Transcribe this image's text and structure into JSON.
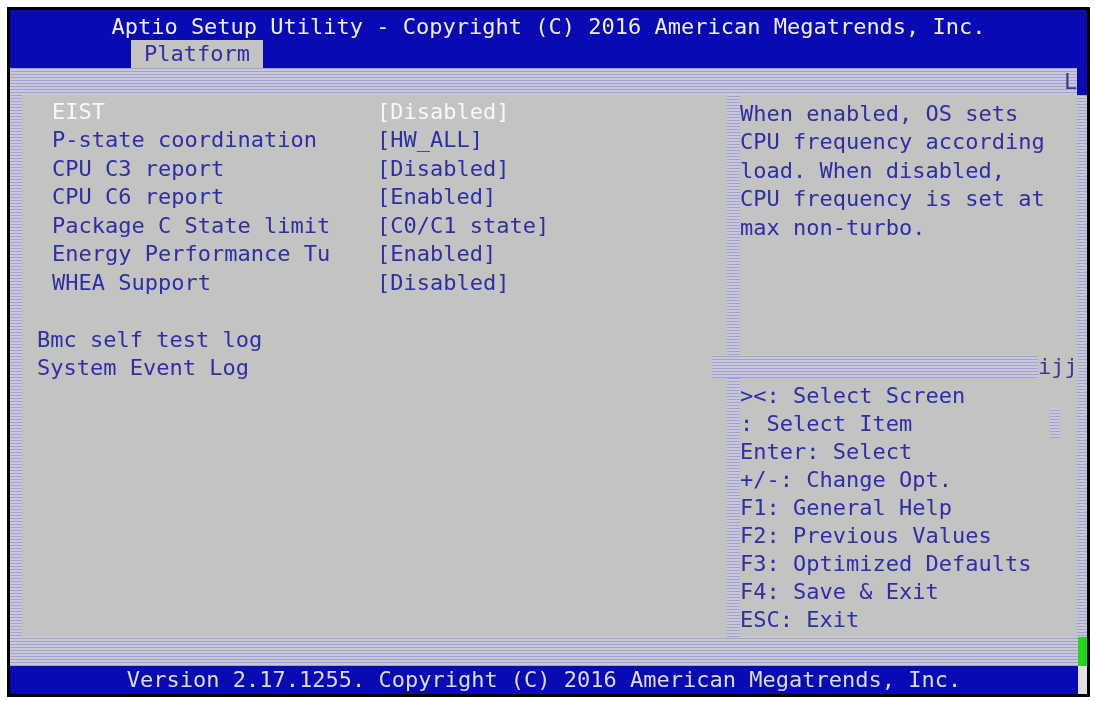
{
  "window": {
    "title": "Aptio Setup Utility - Copyright (C) 2016 American Megatrends, Inc."
  },
  "tabs": [
    {
      "label": "Platform",
      "selected": true
    }
  ],
  "frame_glyphs": {
    "top_right": "L",
    "divider": "ijj"
  },
  "settings": [
    {
      "kind": "option",
      "label": "EIST",
      "value": "[Disabled]",
      "selected": true
    },
    {
      "kind": "option",
      "label": "P-state coordination",
      "value": "[HW_ALL]",
      "selected": false
    },
    {
      "kind": "option",
      "label": "CPU C3 report",
      "value": "[Disabled]",
      "selected": false
    },
    {
      "kind": "option",
      "label": "CPU C6 report",
      "value": "[Enabled]",
      "selected": false
    },
    {
      "kind": "option",
      "label": "Package C State limit",
      "value": "[C0/C1 state]",
      "selected": false
    },
    {
      "kind": "option",
      "label": "Energy Performance Tu",
      "value": "[Enabled]",
      "selected": false
    },
    {
      "kind": "option",
      "label": "WHEA Support",
      "value": "[Disabled]",
      "selected": false
    },
    {
      "kind": "submenu",
      "label": "Bmc self test log",
      "selected": false
    },
    {
      "kind": "submenu",
      "label": "System Event Log",
      "selected": false
    }
  ],
  "help_text": "When enabled, OS sets CPU frequency according load. When disabled, CPU frequency is set at max non-turbo.",
  "key_hints": [
    "><: Select Screen",
    ": Select Item",
    "Enter: Select",
    "+/-: Change Opt.",
    "F1: General Help",
    "F2: Previous Values",
    "F3: Optimized Defaults",
    "F4: Save & Exit",
    "ESC: Exit"
  ],
  "status_bar": "Version 2.17.1255. Copyright (C) 2016 American Megatrends, Inc."
}
